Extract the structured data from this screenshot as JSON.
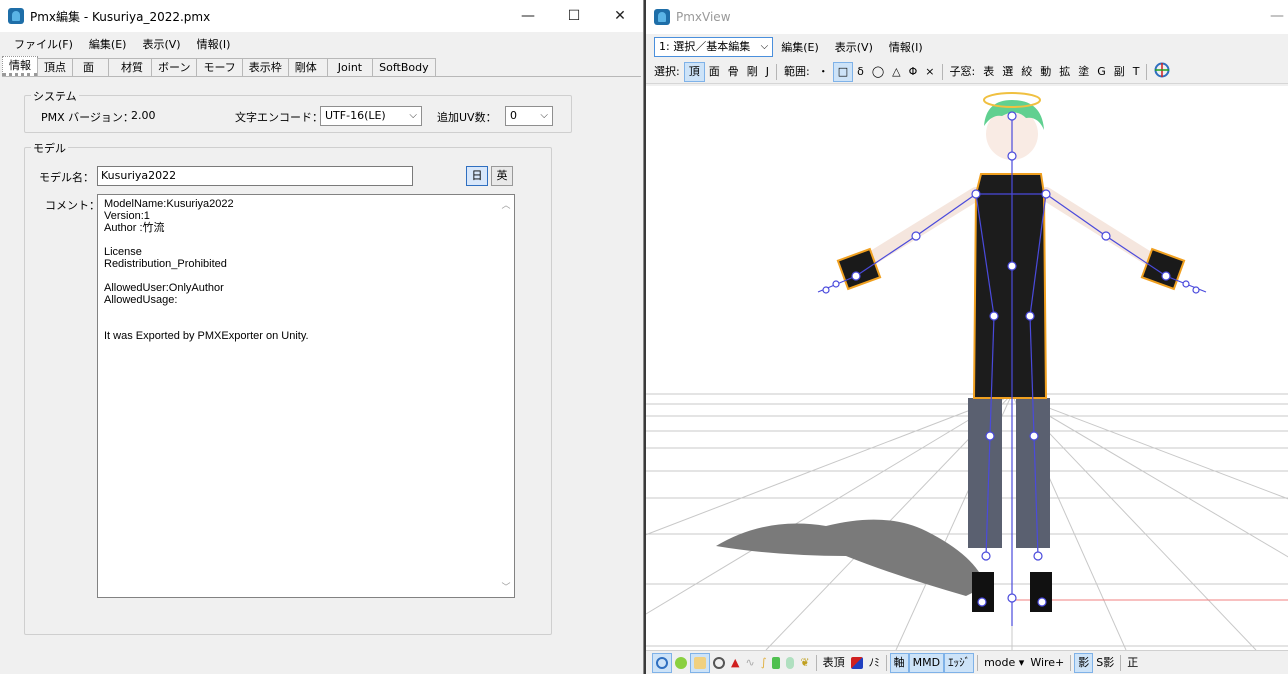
{
  "left_window": {
    "title": "Pmx編集 - Kusuriya_2022.pmx",
    "controls": {
      "minimize": "—",
      "maximize": "☐",
      "close": "✕"
    },
    "menu": [
      "ファイル(F)",
      "編集(E)",
      "表示(V)",
      "情報(I)"
    ],
    "tabs": [
      "情報",
      "頂点",
      "面",
      "材質",
      "ボーン",
      "モーフ",
      "表示枠",
      "剛体",
      "Joint",
      "SoftBody"
    ],
    "active_tab": "情報",
    "system": {
      "legend": "システム",
      "version_label": "PMX バージョン：",
      "version_value": "2.00",
      "encode_label": "文字エンコード：",
      "encode_value": "UTF-16(LE)",
      "uv_label": "追加UV数：",
      "uv_value": "0"
    },
    "model": {
      "legend": "モデル",
      "name_label": "モデル名：",
      "name_value": "Kusuriya2022",
      "lang_jp": "日",
      "lang_en": "英",
      "comment_label": "コメント：",
      "comment_lines": [
        "ModelName:Kusuriya2022",
        "Version:1",
        "Author :竹流",
        "",
        "License",
        "Redistribution_Prohibited",
        "",
        "AllowedUser:OnlyAuthor",
        "AllowedUsage:",
        "",
        "",
        "It was Exported by PMXExporter on Unity."
      ]
    }
  },
  "right_window": {
    "title": "PmxView",
    "minimize": "—",
    "mode_select": "1: 選択／基本編集",
    "menu": [
      "編集(E)",
      "表示(V)",
      "情報(I)"
    ],
    "toolbar": {
      "select_label": "選択:",
      "select_items": [
        "頂",
        "面",
        "骨",
        "剛",
        "J"
      ],
      "range_label": "範囲:",
      "range_items": [
        "・",
        "□",
        "δ",
        "◯",
        "△",
        "Φ",
        "×"
      ],
      "sub_label": "子窓:",
      "sub_items": [
        "表",
        "選",
        "絞",
        "動",
        "拡",
        "塗",
        "G",
        "副",
        "T"
      ]
    },
    "bottombar": [
      "表頂",
      "ﾉﾐ",
      "軸",
      "MMD",
      "ｴｯｼﾞ",
      "mode ▾",
      "Wire+",
      "影",
      "S影",
      "正"
    ],
    "colors": {
      "bone": "#4a4adc",
      "outline": "#f0a020",
      "accent": "#2f6fc0"
    }
  }
}
